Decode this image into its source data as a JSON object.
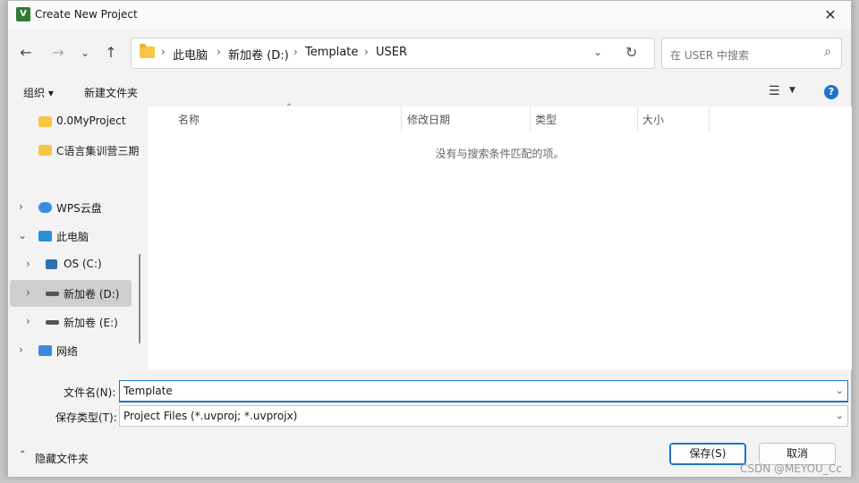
{
  "window": {
    "title": "Create New Project",
    "app_icon_letter": "V"
  },
  "nav": {
    "back_icon": "arrow-left-icon",
    "forward_icon": "arrow-right-icon",
    "recent_icon": "chevron-down-icon",
    "up_icon": "arrow-up-icon",
    "breadcrumbs": [
      "此电脑",
      "新加卷 (D:)",
      "Template",
      "USER"
    ],
    "search_placeholder": "在 USER 中搜索"
  },
  "toolbar": {
    "organize": "组织 ▾",
    "new_folder": "新建文件夹"
  },
  "sidebar": {
    "items": [
      {
        "label": "0.0MyProject",
        "icon": "folder-icon"
      },
      {
        "label": "C语言集训营三期",
        "icon": "folder-icon"
      },
      {
        "label": "WPS云盘",
        "icon": "cloud-icon"
      },
      {
        "label": "此电脑",
        "icon": "computer-icon"
      },
      {
        "label": "OS (C:)",
        "icon": "os-drive-icon"
      },
      {
        "label": "新加卷 (D:)",
        "icon": "drive-icon"
      },
      {
        "label": "新加卷 (E:)",
        "icon": "drive-icon"
      },
      {
        "label": "网络",
        "icon": "network-icon"
      }
    ]
  },
  "content": {
    "columns": [
      "名称",
      "修改日期",
      "类型",
      "大小"
    ],
    "empty_message": "没有与搜索条件匹配的项。"
  },
  "form": {
    "filename_label": "文件名(N):",
    "filename_value": "Template",
    "filetype_label": "保存类型(T):",
    "filetype_value": "Project Files (*.uvproj; *.uvprojx)"
  },
  "footer": {
    "hide_folders": "隐藏文件夹",
    "save": "保存(S)",
    "cancel": "取消",
    "watermark": "CSDN @MEYOU_Cc"
  },
  "colors": {
    "accent": "#1f73c9",
    "folder": "#f6c645",
    "selected": "#cfcfcf"
  }
}
